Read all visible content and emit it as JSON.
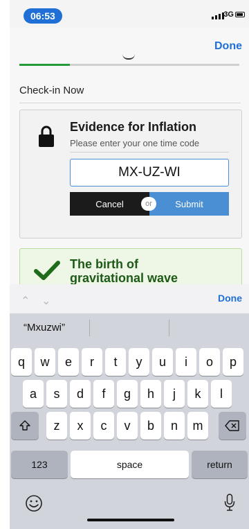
{
  "status_bar": {
    "time": "06:53",
    "network": "3G"
  },
  "nav": {
    "done_label": "Done",
    "progress": 0.23
  },
  "section": {
    "title": "Check-in Now"
  },
  "card": {
    "title": "Evidence for Inflation",
    "subtitle": "Please enter your one time code",
    "code_value": "MX-UZ-WI",
    "cancel_label": "Cancel",
    "or_label": "or",
    "submit_label": "Submit"
  },
  "card2": {
    "title_line1": "The birth of",
    "title_line2": "gravitational wave"
  },
  "keyboard": {
    "done_label": "Done",
    "suggestions": [
      "“Mxuzwi”",
      "",
      ""
    ],
    "row1": [
      "q",
      "w",
      "e",
      "r",
      "t",
      "y",
      "u",
      "i",
      "o",
      "p"
    ],
    "row2": [
      "a",
      "s",
      "d",
      "f",
      "g",
      "h",
      "j",
      "k",
      "l"
    ],
    "row3": [
      "z",
      "x",
      "c",
      "v",
      "b",
      "n",
      "m"
    ],
    "numbers_label": "123",
    "space_label": "space",
    "return_label": "return"
  },
  "colors": {
    "accent": "#1f6fd6",
    "success": "#239a3b",
    "submit": "#4a8fd4",
    "cancel": "#1b1b1b"
  }
}
